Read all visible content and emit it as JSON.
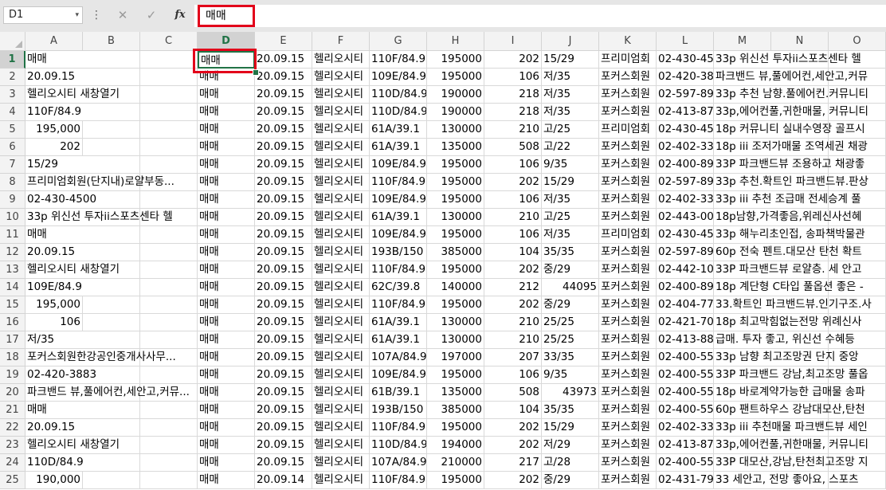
{
  "name_box": "D1",
  "formula_value": "매매",
  "icons": {
    "cancel": "✕",
    "confirm": "✓",
    "function": "fx",
    "more": "⋮",
    "dropdown": "▾"
  },
  "columns": [
    "A",
    "B",
    "C",
    "D",
    "E",
    "F",
    "G",
    "H",
    "I",
    "J",
    "K",
    "L",
    "M",
    "N",
    "O"
  ],
  "selected_column": "D",
  "row_numbers": [
    "1",
    "2",
    "3",
    "4",
    "5",
    "6",
    "7",
    "8",
    "9",
    "10",
    "11",
    "12",
    "13",
    "14",
    "15",
    "16",
    "17",
    "18",
    "19",
    "20",
    "21",
    "22",
    "23",
    "24",
    "25"
  ],
  "rows": [
    {
      "a": "매매",
      "d": "매매",
      "e": "20.09.15",
      "f": "헬리오시티",
      "g": "110F/84.9",
      "h": "195000",
      "i": "202",
      "j": "15/29",
      "k": "프리미엄회",
      "l": "02-430-45",
      "m": "33p 위신선 투자ii스포츠센타 헬"
    },
    {
      "a": "20.09.15",
      "d": "매매",
      "e": "20.09.15",
      "f": "헬리오시티",
      "g": "109E/84.9",
      "h": "195000",
      "i": "106",
      "j": "저/35",
      "k": "포커스회원",
      "l": "02-420-38",
      "m": "파크밴드 뷰,풀에어컨,세안고,커뮤"
    },
    {
      "a": "헬리오시티 새창열기",
      "d": "매매",
      "e": "20.09.15",
      "f": "헬리오시티",
      "g": "110D/84.9",
      "h": "190000",
      "i": "218",
      "j": "저/35",
      "k": "포커스회원",
      "l": "02-597-89",
      "m": "33p 추천 남향.풀에어컨.커뮤니티"
    },
    {
      "a": "110F/84.9",
      "d": "매매",
      "e": "20.09.15",
      "f": "헬리오시티",
      "g": "110D/84.9",
      "h": "190000",
      "i": "218",
      "j": "저/35",
      "k": "포커스회원",
      "l": "02-413-87",
      "m": "33p,에어컨풀,귀한매물, 커뮤니티"
    },
    {
      "a": "195,000",
      "an": true,
      "d": "매매",
      "e": "20.09.15",
      "f": "헬리오시티",
      "g": "61A/39.1",
      "h": "130000",
      "i": "210",
      "j": "고/25",
      "k": "프리미엄회",
      "l": "02-430-45",
      "m": "18p 커뮤니티 실내수영장 골프시"
    },
    {
      "a": "202",
      "an": true,
      "d": "매매",
      "e": "20.09.15",
      "f": "헬리오시티",
      "g": "61A/39.1",
      "h": "135000",
      "i": "508",
      "j": "고/22",
      "k": "포커스회원",
      "l": "02-402-33",
      "m": "18p iii 조저가매물 조역세권 채광"
    },
    {
      "a": "15/29",
      "d": "매매",
      "e": "20.09.15",
      "f": "헬리오시티",
      "g": "109E/84.9",
      "h": "195000",
      "i": "106",
      "j": "9/35",
      "k": "포커스회원",
      "l": "02-400-89",
      "m": "33P 파크밴드뷰 조용하고 채광좋"
    },
    {
      "a": "프리미엄회원(단지내)로얄부동...",
      "d": "매매",
      "e": "20.09.15",
      "f": "헬리오시티",
      "g": "110F/84.9",
      "h": "195000",
      "i": "202",
      "j": "15/29",
      "k": "포커스회원",
      "l": "02-597-89",
      "m": "33p 추천.확트인 파크밴드뷰.판상"
    },
    {
      "a": "02-430-4500",
      "d": "매매",
      "e": "20.09.15",
      "f": "헬리오시티",
      "g": "109E/84.9",
      "h": "195000",
      "i": "106",
      "j": "저/35",
      "k": "포커스회원",
      "l": "02-402-33",
      "m": "33p iii 추천 조급매 전세승계 풀"
    },
    {
      "a": "33p 위신선 투자ii스포츠센타 헬",
      "d": "매매",
      "e": "20.09.15",
      "f": "헬리오시티",
      "g": "61A/39.1",
      "h": "130000",
      "i": "210",
      "j": "고/25",
      "k": "포커스회원",
      "l": "02-443-00",
      "m": "18p남향,가격좋음,위레신사선혜"
    },
    {
      "a": "매매",
      "d": "매매",
      "e": "20.09.15",
      "f": "헬리오시티",
      "g": "109E/84.9",
      "h": "195000",
      "i": "106",
      "j": "저/35",
      "k": "프리미엄회",
      "l": "02-430-45",
      "m": "33p 해누리초인접, 송파책박물관"
    },
    {
      "a": "20.09.15",
      "d": "매매",
      "e": "20.09.15",
      "f": "헬리오시티",
      "g": "193B/150",
      "h": "385000",
      "i": "104",
      "j": "35/35",
      "k": "포커스회원",
      "l": "02-597-89",
      "m": "60p 전숙 펜트.대모산 탄천 확트"
    },
    {
      "a": "헬리오시티 새창열기",
      "d": "매매",
      "e": "20.09.15",
      "f": "헬리오시티",
      "g": "110F/84.9",
      "h": "195000",
      "i": "202",
      "j": "중/29",
      "k": "포커스회원",
      "l": "02-442-10",
      "m": "33P 파크밴드뷰 로얄층. 세 안고"
    },
    {
      "a": "109E/84.9",
      "d": "매매",
      "e": "20.09.15",
      "f": "헬리오시티",
      "g": "62C/39.8",
      "h": "140000",
      "i": "212",
      "j": "44095",
      "jn": true,
      "k": "포커스회원",
      "l": "02-400-89",
      "m": "18p 계단형 C타입 풀옵션 좋은 -"
    },
    {
      "a": "195,000",
      "an": true,
      "d": "매매",
      "e": "20.09.15",
      "f": "헬리오시티",
      "g": "110F/84.9",
      "h": "195000",
      "i": "202",
      "j": "중/29",
      "k": "포커스회원",
      "l": "02-404-77",
      "m": "33.확트인 파크밴드뷰.인기구조.사"
    },
    {
      "a": "106",
      "an": true,
      "d": "매매",
      "e": "20.09.15",
      "f": "헬리오시티",
      "g": "61A/39.1",
      "h": "130000",
      "i": "210",
      "j": "25/25",
      "k": "포커스회원",
      "l": "02-421-70",
      "m": "18p 최고막힘없는전망 위례신사"
    },
    {
      "a": "저/35",
      "d": "매매",
      "e": "20.09.15",
      "f": "헬리오시티",
      "g": "61A/39.1",
      "h": "130000",
      "i": "210",
      "j": "25/25",
      "k": "포커스회원",
      "l": "02-413-88",
      "m": "급매. 투자 좋고, 위신선 수혜등"
    },
    {
      "a": "포커스회원한강공인중개사사무...",
      "d": "매매",
      "e": "20.09.15",
      "f": "헬리오시티",
      "g": "107A/84.9",
      "h": "197000",
      "i": "207",
      "j": "33/35",
      "k": "포커스회원",
      "l": "02-400-55",
      "m": "33p 남향 최고조망권 단지 중앙"
    },
    {
      "a": "02-420-3883",
      "d": "매매",
      "e": "20.09.15",
      "f": "헬리오시티",
      "g": "109E/84.9",
      "h": "195000",
      "i": "106",
      "j": "9/35",
      "k": "포커스회원",
      "l": "02-400-55",
      "m": "33P 파크밴드 강남,최고조망 풀옵"
    },
    {
      "a": "파크밴드 뷰,풀에어컨,세안고,커뮤...",
      "d": "매매",
      "e": "20.09.15",
      "f": "헬리오시티",
      "g": "61B/39.1",
      "h": "135000",
      "i": "508",
      "j": "43973",
      "jn": true,
      "k": "포커스회원",
      "l": "02-400-55",
      "m": "18p 바로계약가능한 급매물 송파"
    },
    {
      "a": "매매",
      "d": "매매",
      "e": "20.09.15",
      "f": "헬리오시티",
      "g": "193B/150",
      "h": "385000",
      "i": "104",
      "j": "35/35",
      "k": "포커스회원",
      "l": "02-400-55",
      "m": "60p 팬트하우스 강남대모산,탄천"
    },
    {
      "a": "20.09.15",
      "d": "매매",
      "e": "20.09.15",
      "f": "헬리오시티",
      "g": "110F/84.9",
      "h": "195000",
      "i": "202",
      "j": "15/29",
      "k": "포커스회원",
      "l": "02-402-33",
      "m": "33p iii 추천매물 파크밴드뷰 세인"
    },
    {
      "a": "헬리오시티 새창열기",
      "d": "매매",
      "e": "20.09.15",
      "f": "헬리오시티",
      "g": "110D/84.9",
      "h": "194000",
      "i": "202",
      "j": "저/29",
      "k": "포커스회원",
      "l": "02-413-87",
      "m": "33p,에어컨풀,귀한매물, 커뮤니티"
    },
    {
      "a": "110D/84.9",
      "d": "매매",
      "e": "20.09.15",
      "f": "헬리오시티",
      "g": "107A/84.9",
      "h": "210000",
      "i": "217",
      "j": "고/28",
      "k": "포커스회원",
      "l": "02-400-55",
      "m": "33P 대모산,강남,탄천최고조망 지"
    },
    {
      "a": "190,000",
      "an": true,
      "d": "매매",
      "e": "20.09.14",
      "f": "헬리오시티",
      "g": "110F/84.9",
      "h": "195000",
      "i": "202",
      "j": "중/29",
      "k": "포커스회원",
      "l": "02-431-79",
      "m": "33 세안고, 전망 좋아요, 스포츠"
    }
  ]
}
